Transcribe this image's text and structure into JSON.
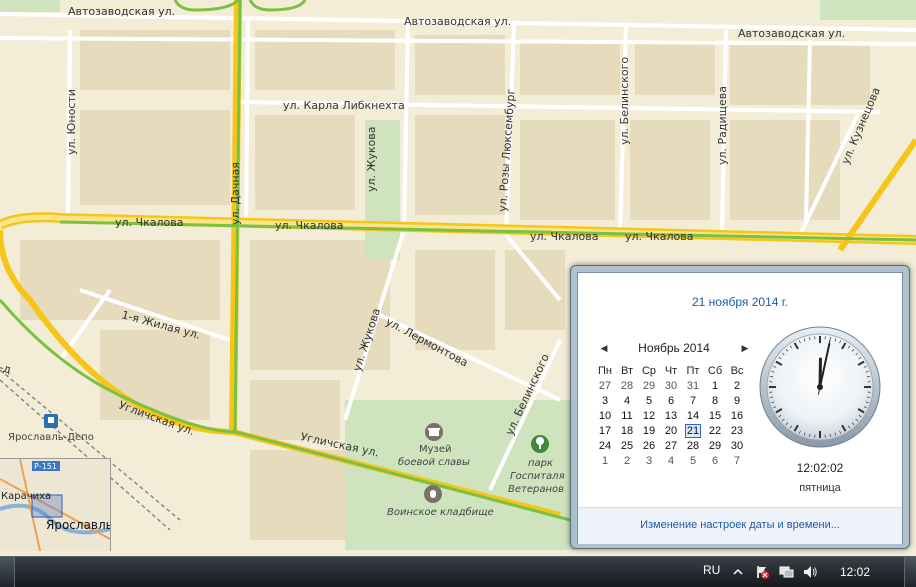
{
  "map": {
    "streets": {
      "avtozavodskaya_1": "Автозаводская ул.",
      "avtozavodskaya_2": "Автозаводская ул.",
      "avtozavodskaya_3": "Автозаводская ул.",
      "yunosti": "ул. Юности",
      "karla_libknehta": "ул. Карла Либкнехта",
      "zhukova_1": "ул. Жукова",
      "zhukova_2": "ул. Жукова",
      "rozy_lyuksemburg": "ул. Розы Люксембург",
      "belinskogo_1": "ул. Белинского",
      "belinskogo_2": "ул. Белинского",
      "radishcheva": "ул. Радищева",
      "kuznetsova": "ул. Кузнецова",
      "chkalova_1": "ул. Чкалова",
      "chkalova_2": "ул. Чкалова",
      "chkalova_3": "ул. Чкалова",
      "chkalova_4": "ул. Чкалова",
      "zhilaya": "1-я Жилая ул.",
      "lermontova": "ул. Лермонтова",
      "uglichskaya_1": "Угличская ул.",
      "uglichskaya_2": "Угличская ул.",
      "dachnaya": "ул. Дачная",
      "moskovsky": "Московский пр-д"
    },
    "pois": {
      "museum_1": "Музей",
      "museum_2": "боевой славы",
      "station": "Ярославль-Депо",
      "park_1": "парк",
      "park_2": "Госпиталя",
      "park_3": "Ветеранов",
      "cemetery": "Воинское кладбище"
    },
    "minimap": {
      "road_label": "Р-151",
      "town_1": "Карачиха",
      "city": "Ярославль"
    }
  },
  "flyout": {
    "date_link": "21 ноября 2014 г.",
    "month_title": "Ноябрь 2014",
    "weekdays": [
      "Пн",
      "Вт",
      "Ср",
      "Чт",
      "Пт",
      "Сб",
      "Вс"
    ],
    "weeks": [
      [
        "27",
        "28",
        "29",
        "30",
        "31",
        "1",
        "2"
      ],
      [
        "3",
        "4",
        "5",
        "6",
        "7",
        "8",
        "9"
      ],
      [
        "10",
        "11",
        "12",
        "13",
        "14",
        "15",
        "16"
      ],
      [
        "17",
        "18",
        "19",
        "20",
        "21",
        "22",
        "23"
      ],
      [
        "24",
        "25",
        "26",
        "27",
        "28",
        "29",
        "30"
      ],
      [
        "1",
        "2",
        "3",
        "4",
        "5",
        "6",
        "7"
      ]
    ],
    "today": "21",
    "clock_time": "12:02:02",
    "clock_day": "пятница",
    "change_link": "Изменение настроек даты и времени..."
  },
  "taskbar": {
    "language": "RU",
    "time": "12:02"
  },
  "colors": {
    "link": "#1e5aa8",
    "road_major": "#f5c518",
    "tram": "#7ac143",
    "taskbar": "#20252b"
  },
  "icons": [
    "chevron-left-icon",
    "chevron-right-icon",
    "show-hidden-icons-icon",
    "action-center-icon",
    "network-icon",
    "volume-icon",
    "museum-icon",
    "park-icon",
    "cemetery-icon",
    "railway-station-icon"
  ]
}
